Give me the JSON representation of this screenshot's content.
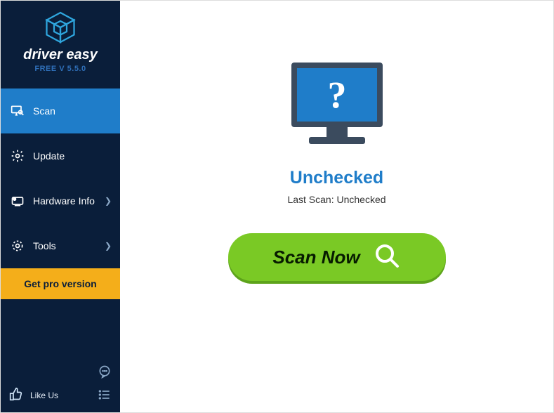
{
  "brand": {
    "name": "driver easy",
    "version_line": "FREE V 5.5.0"
  },
  "sidebar": {
    "items": [
      {
        "label": "Scan"
      },
      {
        "label": "Update"
      },
      {
        "label": "Hardware Info"
      },
      {
        "label": "Tools"
      }
    ],
    "cta": "Get pro version",
    "like": "Like Us"
  },
  "main": {
    "status_title": "Unchecked",
    "status_sub": "Last Scan: Unchecked",
    "scan_button": "Scan Now"
  }
}
